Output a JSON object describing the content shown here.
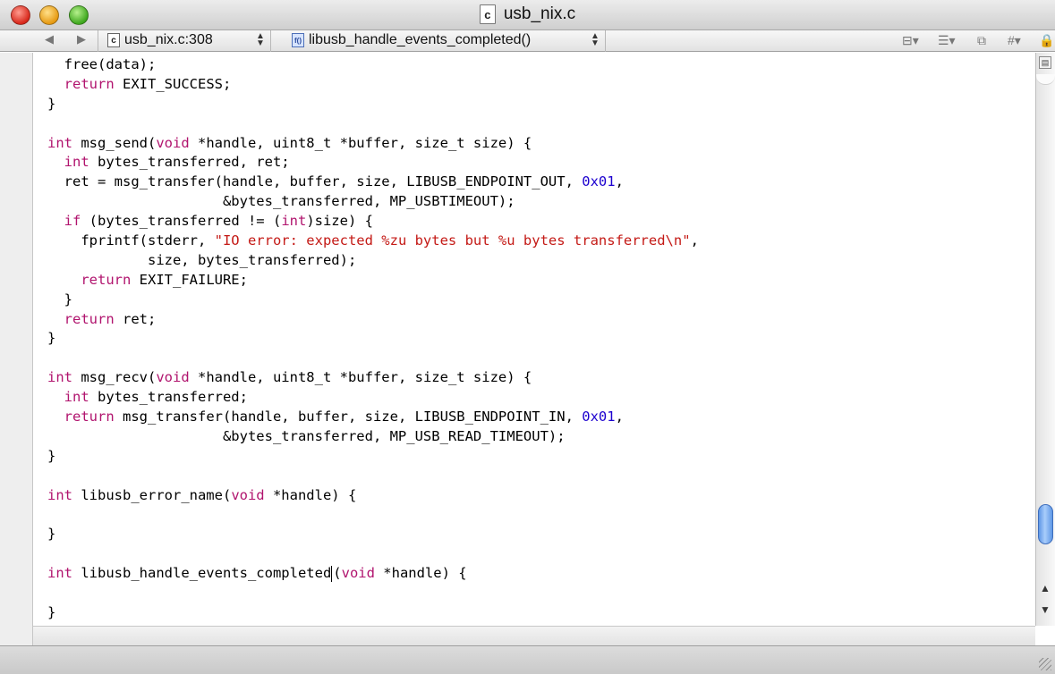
{
  "window": {
    "title": "usb_nix.c",
    "file_icon_letter": "c"
  },
  "navbar": {
    "back_arrow": "◀",
    "forward_arrow": "▶",
    "file_popup_label": "usb_nix.c:308",
    "file_popup_icon": "c",
    "function_popup_label": "libusb_handle_events_completed()",
    "function_popup_icon": "f()",
    "icons": [
      "bookmarks-icon",
      "breakpoints-icon",
      "counterpart-icon",
      "includes-icon",
      "lock-icon"
    ]
  },
  "editor": {
    "lines": [
      [
        {
          "t": "  free(data);"
        }
      ],
      [
        {
          "t": "  "
        },
        {
          "t": "return",
          "c": "kw"
        },
        {
          "t": " EXIT_SUCCESS;"
        }
      ],
      [
        {
          "t": "}"
        }
      ],
      [
        {
          "t": ""
        }
      ],
      [
        {
          "t": "int",
          "c": "kw"
        },
        {
          "t": " msg_send("
        },
        {
          "t": "void",
          "c": "kw"
        },
        {
          "t": " *handle, uint8_t *buffer, size_t size) {"
        }
      ],
      [
        {
          "t": "  "
        },
        {
          "t": "int",
          "c": "kw"
        },
        {
          "t": " bytes_transferred, ret;"
        }
      ],
      [
        {
          "t": "  ret = msg_transfer(handle, buffer, size, LIBUSB_ENDPOINT_OUT, "
        },
        {
          "t": "0x01",
          "c": "num"
        },
        {
          "t": ","
        }
      ],
      [
        {
          "t": "                     &bytes_transferred, MP_USBTIMEOUT);"
        }
      ],
      [
        {
          "t": "  "
        },
        {
          "t": "if",
          "c": "kw"
        },
        {
          "t": " (bytes_transferred != ("
        },
        {
          "t": "int",
          "c": "kw"
        },
        {
          "t": ")size) {"
        }
      ],
      [
        {
          "t": "    fprintf(stderr, "
        },
        {
          "t": "\"IO error: expected %zu bytes but %u bytes transferred\\n\"",
          "c": "str"
        },
        {
          "t": ","
        }
      ],
      [
        {
          "t": "            size, bytes_transferred);"
        }
      ],
      [
        {
          "t": "    "
        },
        {
          "t": "return",
          "c": "kw"
        },
        {
          "t": " EXIT_FAILURE;"
        }
      ],
      [
        {
          "t": "  }"
        }
      ],
      [
        {
          "t": "  "
        },
        {
          "t": "return",
          "c": "kw"
        },
        {
          "t": " ret;"
        }
      ],
      [
        {
          "t": "}"
        }
      ],
      [
        {
          "t": ""
        }
      ],
      [
        {
          "t": "int",
          "c": "kw"
        },
        {
          "t": " msg_recv("
        },
        {
          "t": "void",
          "c": "kw"
        },
        {
          "t": " *handle, uint8_t *buffer, size_t size) {"
        }
      ],
      [
        {
          "t": "  "
        },
        {
          "t": "int",
          "c": "kw"
        },
        {
          "t": " bytes_transferred;"
        }
      ],
      [
        {
          "t": "  "
        },
        {
          "t": "return",
          "c": "kw"
        },
        {
          "t": " msg_transfer(handle, buffer, size, LIBUSB_ENDPOINT_IN, "
        },
        {
          "t": "0x01",
          "c": "num"
        },
        {
          "t": ","
        }
      ],
      [
        {
          "t": "                     &bytes_transferred, MP_USB_READ_TIMEOUT);"
        }
      ],
      [
        {
          "t": "}"
        }
      ],
      [
        {
          "t": ""
        }
      ],
      [
        {
          "t": "int",
          "c": "kw"
        },
        {
          "t": " libusb_error_name("
        },
        {
          "t": "void",
          "c": "kw"
        },
        {
          "t": " *handle) {"
        }
      ],
      [
        {
          "t": ""
        }
      ],
      [
        {
          "t": "}"
        }
      ],
      [
        {
          "t": ""
        }
      ],
      [
        {
          "t": "int",
          "c": "kw"
        },
        {
          "t": " libusb_handle_events_completed"
        },
        {
          "caret": true
        },
        {
          "t": "("
        },
        {
          "t": "void",
          "c": "kw"
        },
        {
          "t": " *handle) {"
        }
      ],
      [
        {
          "t": ""
        }
      ],
      [
        {
          "t": "}"
        }
      ]
    ],
    "colors": {
      "keyword": "#b1146e",
      "string": "#c41a16",
      "number": "#1c00cf"
    },
    "scroll_position_fraction": 0.92
  }
}
